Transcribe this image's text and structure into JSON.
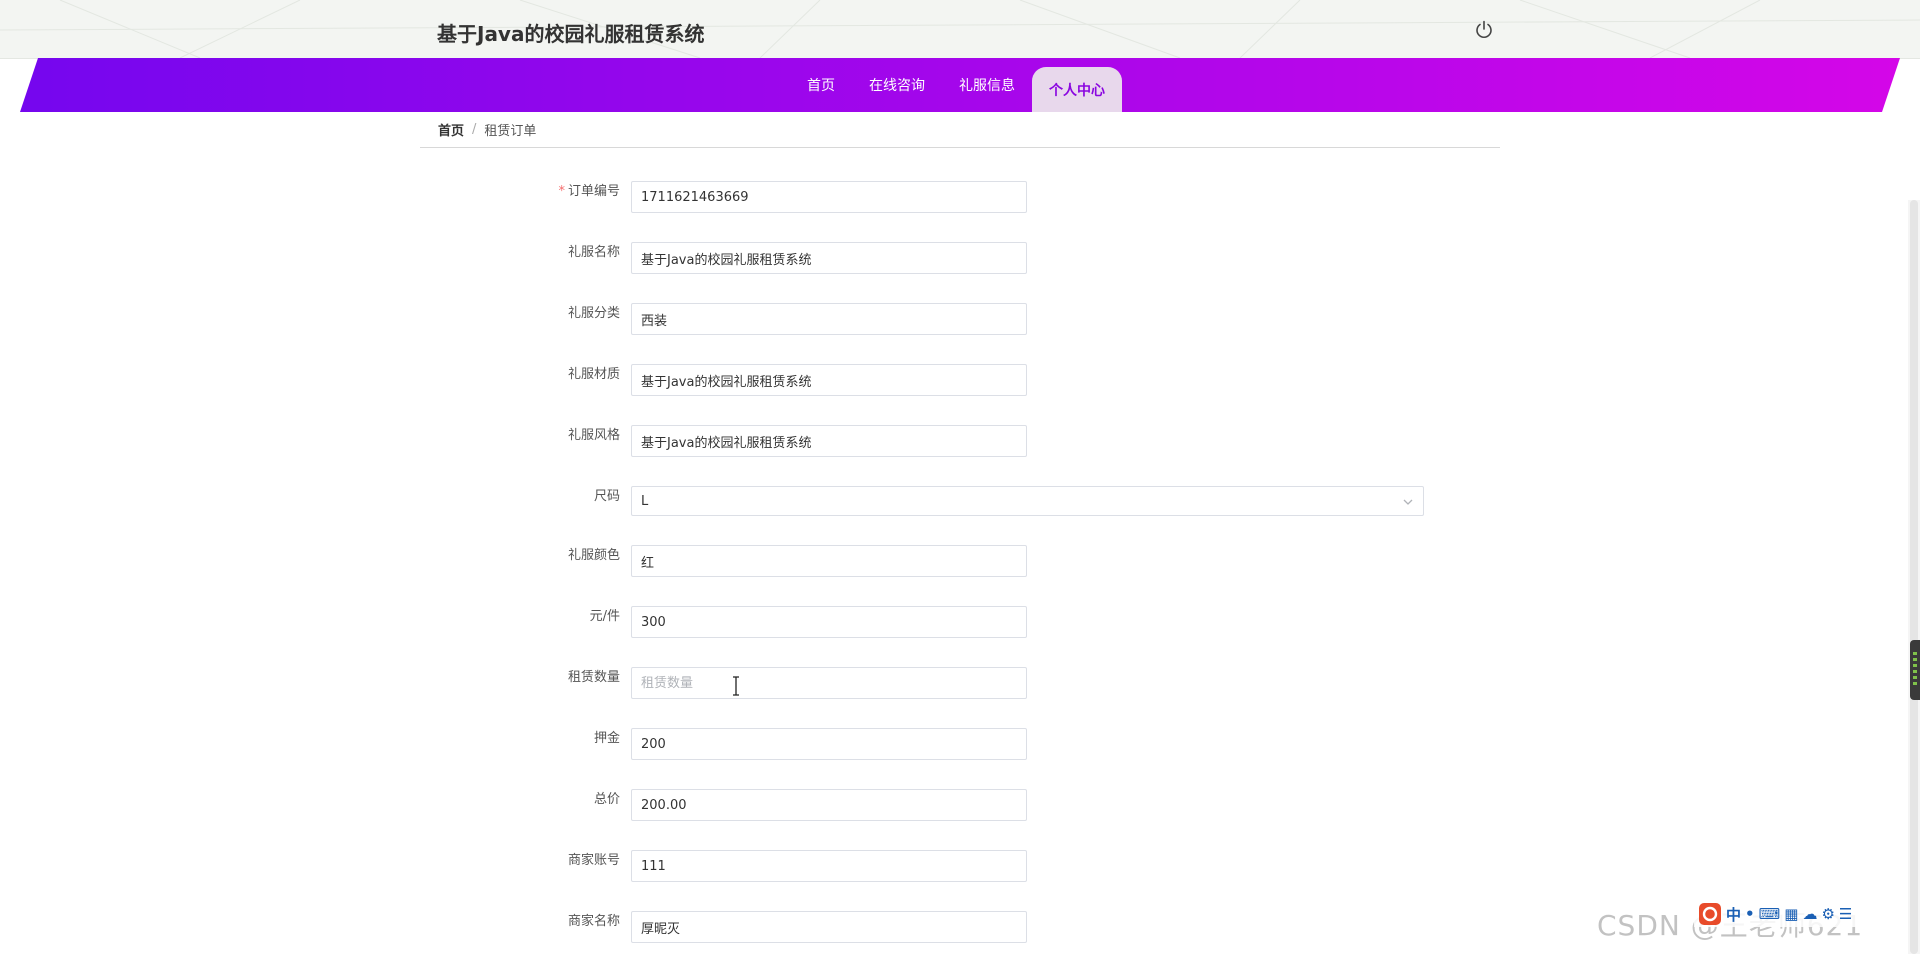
{
  "header": {
    "title": "基于Java的校园礼服租赁系统"
  },
  "nav": {
    "items": [
      {
        "label": "首页"
      },
      {
        "label": "在线咨询"
      },
      {
        "label": "礼服信息"
      },
      {
        "label": "个人中心"
      }
    ],
    "active_index": 3
  },
  "breadcrumb": {
    "home": "首页",
    "separator": "/",
    "current": "租赁订单"
  },
  "form": {
    "fields": [
      {
        "label": "订单编号",
        "required": true,
        "value": "1711621463669"
      },
      {
        "label": "礼服名称",
        "value": "基于Java的校园礼服租赁系统"
      },
      {
        "label": "礼服分类",
        "value": "西装"
      },
      {
        "label": "礼服材质",
        "value": "基于Java的校园礼服租赁系统"
      },
      {
        "label": "礼服风格",
        "value": "基于Java的校园礼服租赁系统"
      },
      {
        "label": "尺码",
        "value": "L",
        "type": "select"
      },
      {
        "label": "礼服颜色",
        "value": "红"
      },
      {
        "label": "元/件",
        "value": "300"
      },
      {
        "label": "租赁数量",
        "value": "",
        "placeholder": "租赁数量"
      },
      {
        "label": "押金",
        "value": "200"
      },
      {
        "label": "总价",
        "value": "200.00"
      },
      {
        "label": "商家账号",
        "value": "111"
      },
      {
        "label": "商家名称",
        "value": "厚昵灭"
      }
    ]
  },
  "required_mark": "*",
  "watermark": "CSDN @王老师621",
  "ime": {
    "items": [
      "中",
      "•",
      "⌨",
      "▦",
      "☁",
      "⚙",
      "☰"
    ]
  },
  "colors": {
    "nav_gradient_start": "#7506ee",
    "nav_gradient_end": "#d406e8",
    "active_tab_bg": "#e8d8ec",
    "active_tab_text": "#8a06e0"
  }
}
